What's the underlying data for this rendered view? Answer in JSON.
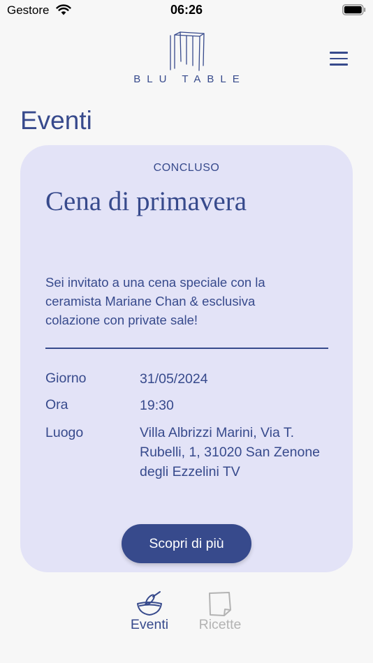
{
  "status_bar": {
    "carrier": "Gestore",
    "time": "06:26"
  },
  "header": {
    "logo_text": "BLU TABLE"
  },
  "page": {
    "title": "Eventi"
  },
  "event": {
    "status": "CONCLUSO",
    "title": "Cena di primavera",
    "description": "Sei invitato a una cena speciale con la ceramista Mariane Chan & esclusiva colazione con private sale!",
    "details": [
      {
        "label": "Giorno",
        "value": "31/05/2024"
      },
      {
        "label": "Ora",
        "value": "19:30"
      },
      {
        "label": "Luogo",
        "value": "Villa Albrizzi Marini, Via T. Rubelli, 1, 31020 San Zenone degli Ezzelini TV"
      }
    ],
    "cta_label": "Scopri di più"
  },
  "tabs": [
    {
      "label": "Eventi",
      "icon": "bowl-whisk-icon",
      "active": true
    },
    {
      "label": "Ricette",
      "icon": "note-page-icon",
      "active": false
    }
  ],
  "colors": {
    "accent": "#374a8c",
    "card_background": "#e3e3f7",
    "page_background": "#f7f7f7",
    "inactive_tab": "#b3b3b3"
  }
}
